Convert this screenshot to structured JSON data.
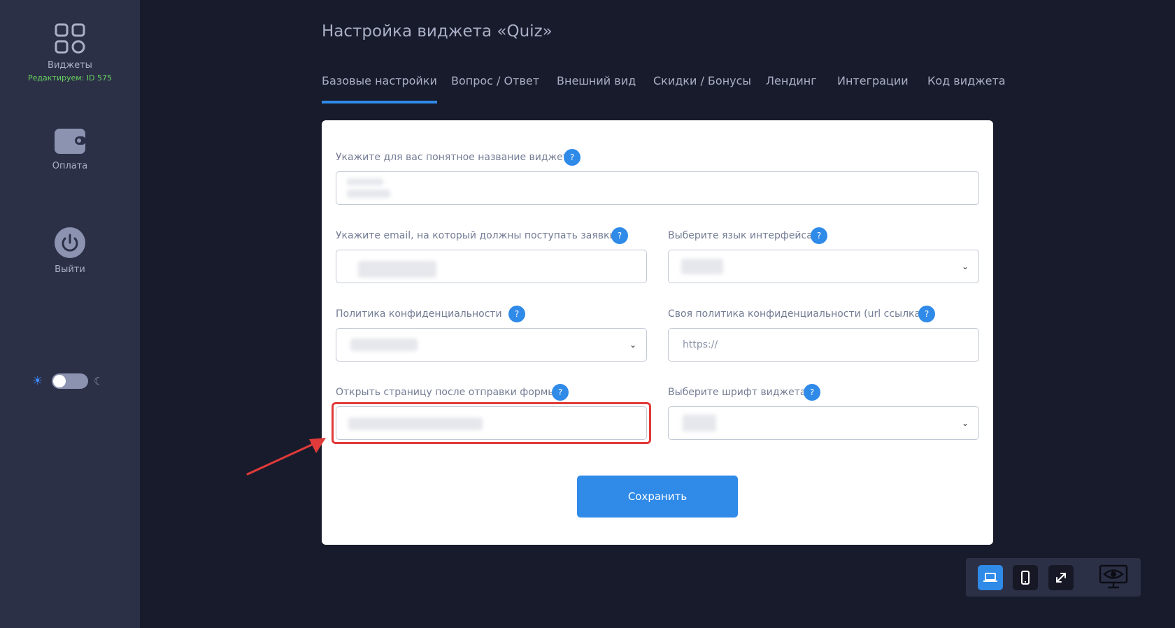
{
  "sidebar": {
    "items": [
      {
        "label": "Виджеты",
        "sub": "Редактируем: ID 575",
        "icon": "widgets-grid-icon"
      },
      {
        "label": "Оплата",
        "icon": "wallet-icon"
      },
      {
        "label": "Выйти",
        "icon": "power-icon"
      }
    ],
    "theme": {
      "light_icon": "☀",
      "dark_icon": "☾",
      "mode": "light"
    }
  },
  "header": {
    "title": "Настройка виджета «Quiz»"
  },
  "tabs": [
    {
      "label": "Базовые настройки",
      "active": true
    },
    {
      "label": "Вопрос / Ответ"
    },
    {
      "label": "Внешний вид"
    },
    {
      "label": "Скидки / Бонусы"
    },
    {
      "label": "Лендинг"
    },
    {
      "label": "Интеграции"
    },
    {
      "label": "Код виджета"
    }
  ],
  "form": {
    "help_glyph": "?",
    "select_chevron": "⌄",
    "widget_name": {
      "label": "Укажите для вас понятное название виджета"
    },
    "email": {
      "label": "Укажите email, на который должны поступать заявки"
    },
    "language": {
      "label": "Выберите язык интерфейса"
    },
    "privacy_policy": {
      "label": "Политика конфиденциальности"
    },
    "custom_policy": {
      "label": "Своя политика конфиденциальности (url ссылка)",
      "placeholder": "https://"
    },
    "redirect_page": {
      "label": "Открыть страницу после отправки формы"
    },
    "font": {
      "label": "Выберите шрифт виджета"
    },
    "save_label": "Сохранить"
  },
  "colors": {
    "accent": "#2f8ae8",
    "highlight": "#e03a3a",
    "sidebar_bg": "#2c3047",
    "page_bg": "#181b2b",
    "editing_green": "#67d45e"
  },
  "preview": {
    "modes": [
      "laptop-icon",
      "mobile-icon",
      "fullscreen-icon",
      "preview-eye-icon"
    ],
    "active": "laptop-icon"
  }
}
